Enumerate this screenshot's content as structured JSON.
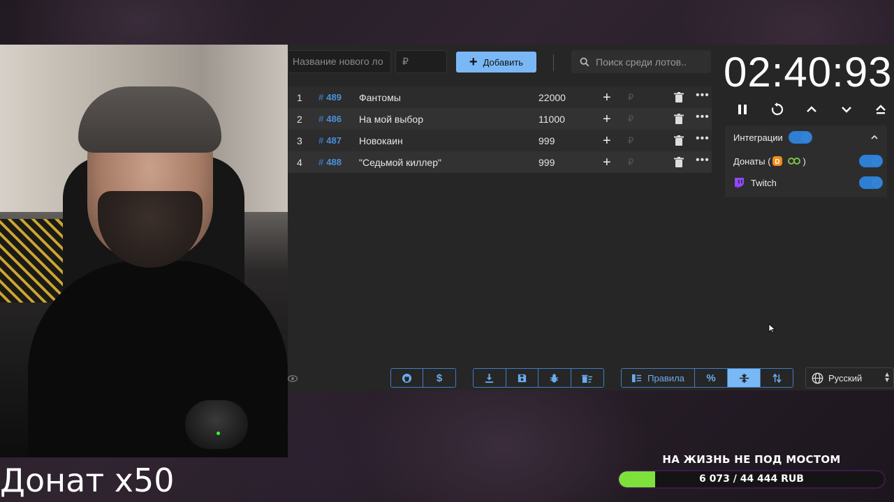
{
  "webcam": {
    "caption": "Донат x50"
  },
  "toolbar": {
    "name_placeholder": "Название нового ло",
    "price_placeholder": "₽",
    "add_label": "Добавить",
    "search_placeholder": "Поиск среди лотов.."
  },
  "lots": [
    {
      "num": "1",
      "id": "489",
      "title": "Фантомы",
      "amount": "22000",
      "currency": "₽"
    },
    {
      "num": "2",
      "id": "486",
      "title": "На мой выбор",
      "amount": "11000",
      "currency": "₽"
    },
    {
      "num": "3",
      "id": "487",
      "title": "Новокаин",
      "amount": "999",
      "currency": "₽"
    },
    {
      "num": "4",
      "id": "488",
      "title": "\"Седьмой киллер\"",
      "amount": "999",
      "currency": "₽"
    }
  ],
  "timer": {
    "value": "02:40:93"
  },
  "integrations": {
    "title": "Интеграции",
    "enabled": true,
    "donations_label": "Донаты (",
    "donations_close": ")",
    "donations_enabled": true,
    "twitch_label": "Twitch",
    "twitch_enabled": true
  },
  "bottom_bar": {
    "rules_label": "Правила",
    "language": "Русский"
  },
  "goal": {
    "title": "НА ЖИЗНЬ НЕ ПОД МОСТОМ",
    "progress_text": "6 073 / 44 444 RUB",
    "fraction": 0.137
  },
  "colors": {
    "accent": "#7ab8f5",
    "toggle": "#2e7fd4",
    "goal_fill": "#7ee03a",
    "lot_id": "#4a90d9"
  }
}
